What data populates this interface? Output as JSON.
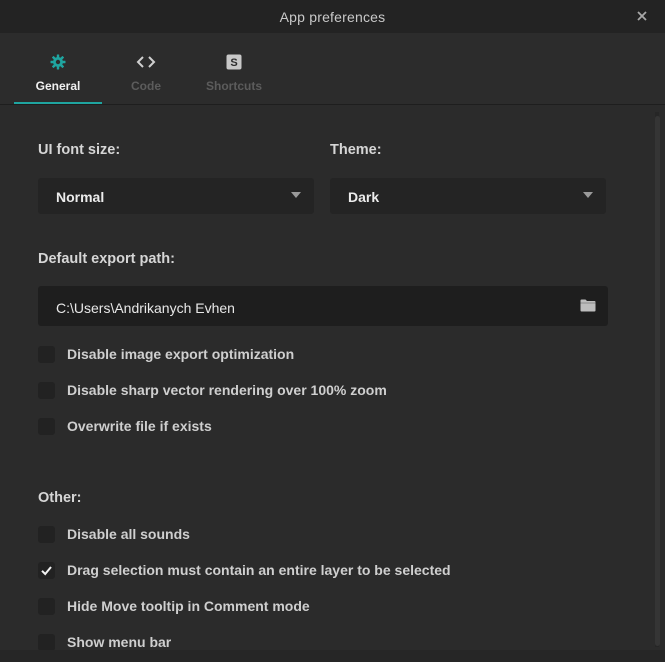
{
  "window": {
    "title": "App preferences",
    "close_icon": "close-icon"
  },
  "tabs": [
    {
      "label": "General",
      "icon": "gear-icon",
      "active": true
    },
    {
      "label": "Code",
      "icon": "code-icon",
      "active": false
    },
    {
      "label": "Shortcuts",
      "icon": "shortcuts-icon",
      "active": false
    }
  ],
  "general": {
    "font_size": {
      "label": "UI font size:",
      "value": "Normal"
    },
    "theme": {
      "label": "Theme:",
      "value": "Dark"
    },
    "export_path": {
      "label": "Default export path:",
      "value": "C:\\Users\\Andrikanych Evhen",
      "icon": "folder-icon"
    },
    "export_options": [
      {
        "label": "Disable image export optimization",
        "checked": false
      },
      {
        "label": "Disable sharp vector rendering over 100% zoom",
        "checked": false
      },
      {
        "label": "Overwrite file if exists",
        "checked": false
      }
    ],
    "other": {
      "label": "Other:",
      "options": [
        {
          "label": "Disable all sounds",
          "checked": false
        },
        {
          "label": "Drag selection must contain an entire layer to be selected",
          "checked": true
        },
        {
          "label": "Hide Move tooltip in Comment mode",
          "checked": false
        },
        {
          "label": "Show menu bar",
          "checked": false
        }
      ]
    }
  },
  "colors": {
    "accent": "#1fa5a0",
    "background": "#2b2b2b",
    "titlebar": "#232323"
  }
}
